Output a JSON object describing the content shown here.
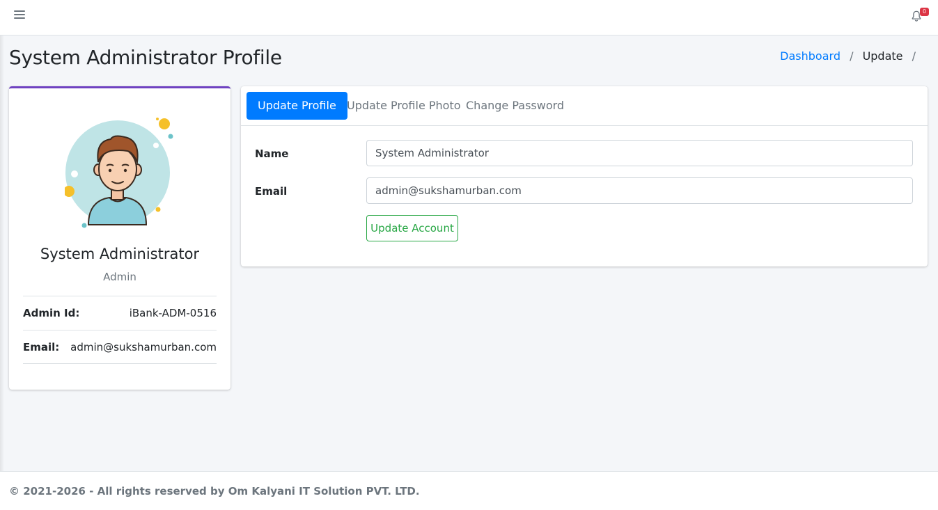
{
  "header": {
    "menu_icon": "hamburger-icon",
    "notification_icon": "bell-icon",
    "notification_count": "0"
  },
  "page": {
    "title": "System Administrator Profile",
    "breadcrumb": [
      {
        "label": "Dashboard",
        "link": true
      },
      {
        "label": "Update",
        "link": false
      }
    ],
    "breadcrumb_separator": "/"
  },
  "profile": {
    "name": "System Administrator",
    "role": "Admin",
    "fields": [
      {
        "label": "Admin Id:",
        "value": "iBank-ADM-0516"
      },
      {
        "label": "Email:",
        "value": "admin@sukshamurban.com"
      }
    ],
    "card_accent": "#6f42c1"
  },
  "tabs": [
    {
      "label": "Update Profile",
      "active": true
    },
    {
      "label": "Update Profile Photo",
      "active": false
    },
    {
      "label": "Change Password",
      "active": false
    }
  ],
  "form": {
    "name_label": "Name",
    "name_value": "System Administrator",
    "email_label": "Email",
    "email_value": "admin@sukshamurban.com",
    "submit_label": "Update Account"
  },
  "footer": {
    "text": "© 2021-2026 - All rights reserved by Om Kalyani IT Solution PVT. LTD."
  },
  "colors": {
    "primary": "#007bff",
    "success": "#28a745",
    "danger": "#dc3545",
    "background": "#f4f6f9"
  }
}
